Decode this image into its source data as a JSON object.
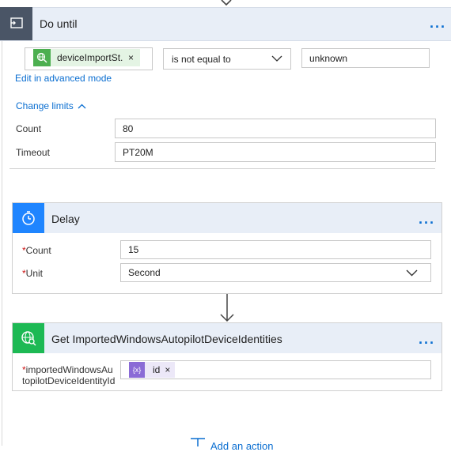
{
  "do_until": {
    "title": "Do until",
    "menu": "...",
    "condition": {
      "left_token": "deviceImportSt...",
      "token_remove": "×",
      "operator": "is not equal to",
      "right_value": "unknown"
    },
    "advanced_link": "Edit in advanced mode",
    "change_limits_link": "Change limits",
    "count_label": "Count",
    "count_value": "80",
    "timeout_label": "Timeout",
    "timeout_value": "PT20M"
  },
  "delay": {
    "title": "Delay",
    "menu": "...",
    "count_label": "Count",
    "count_value": "15",
    "unit_label": "Unit",
    "unit_value": "Second",
    "required_mark": "*"
  },
  "get_identities": {
    "title": "Get ImportedWindowsAutopilotDeviceIdentities",
    "menu": "...",
    "field_label_line1": "importedWindowsAu",
    "field_label_line2": "topilotDeviceIdentityId",
    "required_mark": "*",
    "token_text": "id",
    "token_icon_text": "{x}",
    "token_remove": "×"
  },
  "footer": {
    "add_action": "Add an action"
  },
  "colors": {
    "header_bg": "#e8eef7",
    "dountil_icon_bg": "#4a5566",
    "delay_icon_bg": "#1f85ff",
    "get_icon_bg": "#1db954",
    "token_variable": "#8a6bd6",
    "link": "#0a6ed1"
  },
  "icons": {
    "dountil": "loop-icon",
    "delay": "timer-icon",
    "get": "globe-search-icon",
    "dots": "more-icon",
    "chevron": "chevron-down-icon"
  }
}
